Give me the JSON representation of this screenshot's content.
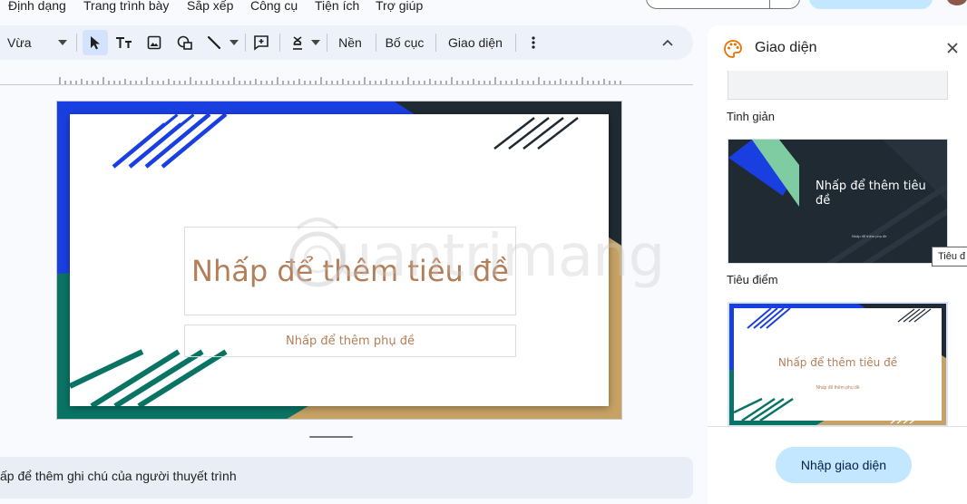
{
  "menu": {
    "items": [
      "Định dạng",
      "Trang trình bày",
      "Sắp xếp",
      "Công cụ",
      "Tiện ích",
      "Trợ giúp"
    ]
  },
  "toolbar": {
    "zoom_value": "Vừa",
    "background_label": "Nền",
    "layout_label": "Bố cục",
    "theme_label": "Giao diện"
  },
  "slide": {
    "title_placeholder": "Nhấp để thêm tiêu đề",
    "subtitle_placeholder": "Nhấp để thêm phụ đề"
  },
  "watermark": {
    "text": "uantrimang"
  },
  "notes": {
    "placeholder": "ấp để thêm ghi chú của người thuyết trình"
  },
  "panel": {
    "title": "Giao diện",
    "themes": [
      {
        "name": "Tinh giản",
        "preview_title": "Nhấp để thêm tiêu đề",
        "preview_subtitle": "Nhấp để thêm phụ đề"
      },
      {
        "name": "Tiêu điểm",
        "preview_title": "Nhấp để thêm tiêu đề",
        "preview_subtitle": "Nhấp để thêm phụ đề"
      }
    ],
    "tooltip": "Tiêu đ",
    "import_button": "Nhập giao diện"
  },
  "colors": {
    "accent_blue": "#1a3fe0",
    "dark_navy": "#1f2a33",
    "teal": "#0a7464",
    "gold": "#c7a264",
    "title_text": "#b27f5a",
    "mint": "#7fcca3",
    "button_blue": "#c2e7ff"
  }
}
